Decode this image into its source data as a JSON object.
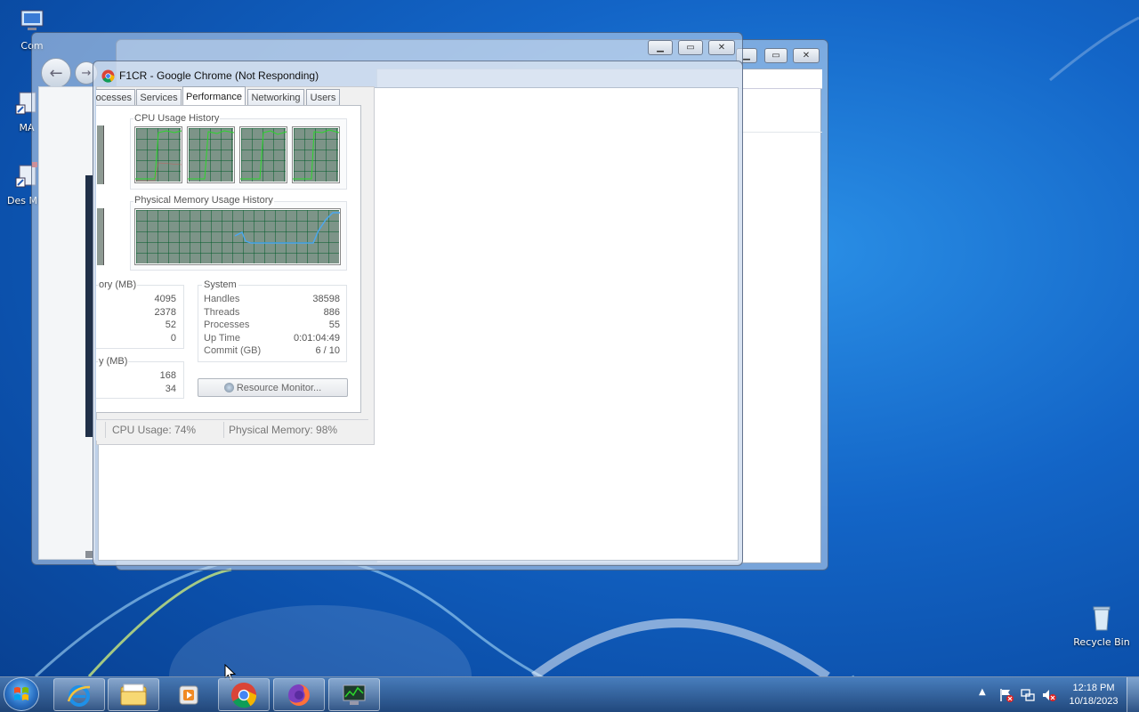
{
  "desktop": {
    "icons": [
      {
        "label": "Com"
      },
      {
        "label": "MA"
      },
      {
        "label": "Des Min"
      },
      {
        "label": "Recycle Bin"
      }
    ]
  },
  "chrome_window": {
    "title": "F1CR - Google Chrome (Not Responding)"
  },
  "task_manager": {
    "tabs": [
      {
        "label": "ocesses"
      },
      {
        "label": "Services"
      },
      {
        "label": "Performance"
      },
      {
        "label": "Networking"
      },
      {
        "label": "Users"
      }
    ],
    "active_tab": "Performance",
    "cpu_history_title": "CPU Usage History",
    "memory_history_title": "Physical Memory Usage History",
    "phys_mem_title": "ory (MB)",
    "phys_mem_values": [
      "4095",
      "2378",
      "52",
      "0"
    ],
    "kernel_mem_title": "y (MB)",
    "kernel_mem_values": [
      "168",
      "34"
    ],
    "system": {
      "title": "System",
      "rows": [
        {
          "label": "Handles",
          "value": "38598"
        },
        {
          "label": "Threads",
          "value": "886"
        },
        {
          "label": "Processes",
          "value": "55"
        },
        {
          "label": "Up Time",
          "value": "0:01:04:49"
        },
        {
          "label": "Commit (GB)",
          "value": "6 / 10"
        }
      ]
    },
    "resource_monitor_label": "Resource Monitor...",
    "status": {
      "cpu": "CPU Usage: 74%",
      "memory": "Physical Memory: 98%"
    }
  },
  "taskbar": {
    "apps": [
      {
        "name": "internet-explorer"
      },
      {
        "name": "file-explorer"
      },
      {
        "name": "media-player"
      },
      {
        "name": "google-chrome"
      },
      {
        "name": "firefox"
      },
      {
        "name": "task-manager"
      }
    ],
    "clock_time": "12:18 PM",
    "clock_date": "10/18/2023"
  },
  "colors": {
    "desktop_blue": "#1365c7",
    "graph_green": "#7d9488",
    "cpu_line": "#2bd62b",
    "memory_line": "#4aa8f0"
  }
}
